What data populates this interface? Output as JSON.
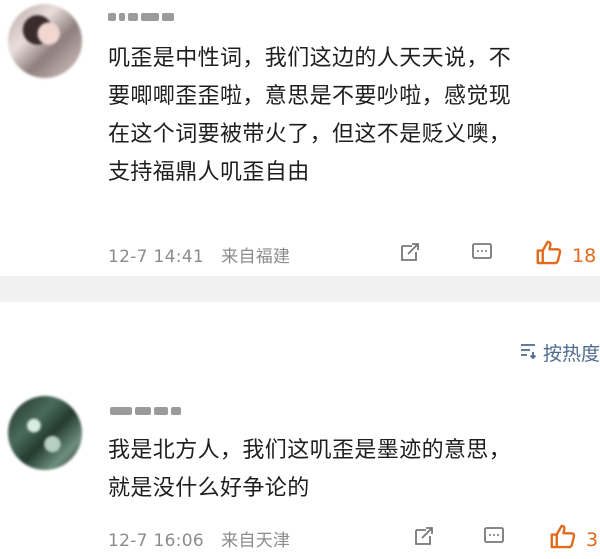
{
  "comments": [
    {
      "text_lines": [
        "叽歪是中性词，我们这边的人天天说，不",
        "要唧唧歪歪啦，意思是不要吵啦，感觉现",
        "在这个词要被带火了，但这不是贬义噢，",
        "支持福鼎人叽歪自由"
      ],
      "date": "12-7 14:41",
      "location": "来自福建",
      "likes": "18"
    },
    {
      "text_lines": [
        "我是北方人，我们这叽歪是墨迹的意思，",
        "就是没什么好争论的"
      ],
      "date": "12-7 16:06",
      "location": "来自天津",
      "likes": "3"
    }
  ],
  "sort": {
    "label": "按热度"
  },
  "icons": {
    "repost": "repost-icon",
    "comment": "comment-icon",
    "like": "thumbs-up-icon",
    "sort": "sort-icon"
  },
  "colors": {
    "like": "#e36a1a",
    "sort": "#4e6a8e",
    "meta": "#8c8c8c"
  }
}
